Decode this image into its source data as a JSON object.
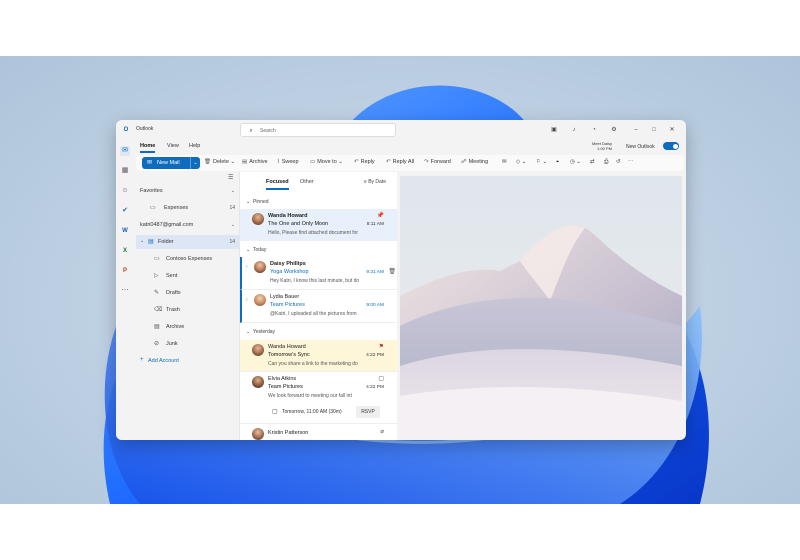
{
  "app": {
    "name": "Outlook"
  },
  "search": {
    "placeholder": "Search"
  },
  "ribbon": {
    "tabs": [
      "Home",
      "View",
      "Help"
    ],
    "meet_now": [
      "Meet Daisy",
      "1:00 PM"
    ],
    "new_outlook_label": "New Outlook",
    "new_outlook_on": true
  },
  "toolbar": {
    "new_mail": "New Mail",
    "buttons": [
      "Delete",
      "Archive",
      "Sweep",
      "Move to",
      "Reply",
      "Reply All",
      "Forward",
      "Meeting"
    ]
  },
  "folders": {
    "favorites": "Favorites",
    "expenses": {
      "label": "Expenses",
      "count": "14"
    },
    "account": "katri0487@gmail.com",
    "folder": {
      "label": "Folder",
      "count": "14"
    },
    "items": [
      "Contoso Expenses",
      "Sent",
      "Drafts",
      "Trash",
      "Archive",
      "Junk"
    ],
    "add_account": "Add Account"
  },
  "list": {
    "tabs": [
      "Focused",
      "Other"
    ],
    "filter": "By Date",
    "sections": {
      "pinned": "Pinned",
      "today": "Today",
      "yesterday": "Yesterday"
    },
    "messages": [
      {
        "from": "Wanda Howard",
        "subject": "The One and Only Moon",
        "time": "8:11 AM",
        "preview": "Hello, Please find attached document for"
      },
      {
        "from": "Daisy Phillips",
        "subject": "Yoga Workshop",
        "time": "9:31 AM",
        "preview": "Hey Katri, I know this last minute, but do"
      },
      {
        "from": "Lydia Bauer",
        "subject": "Team Pictures",
        "time": "9:00 AM",
        "preview": "@Katri, I uploaded all the pictures from"
      },
      {
        "from": "Wanda Howard",
        "subject": "Tomorrow's Sync",
        "time": "4:22 PM",
        "preview": "Can you share a link to the marketing do"
      },
      {
        "from": "Elvia Atkins",
        "subject": "Team Pictures",
        "time": "4:22 PM",
        "preview": "We look forward to meeting our fall int"
      },
      {
        "from": "Kristin Patterson",
        "subject": "",
        "time": "",
        "preview": ""
      }
    ],
    "rsvp": {
      "when": "Tomorrow, 11:00 AM (30m)",
      "button": "RSVP"
    }
  },
  "colors": {
    "accent": "#0f6cbd",
    "selected_row": "#e8f1fb",
    "flagged_row": "#fdf6d8",
    "flag": "#c4314b"
  }
}
